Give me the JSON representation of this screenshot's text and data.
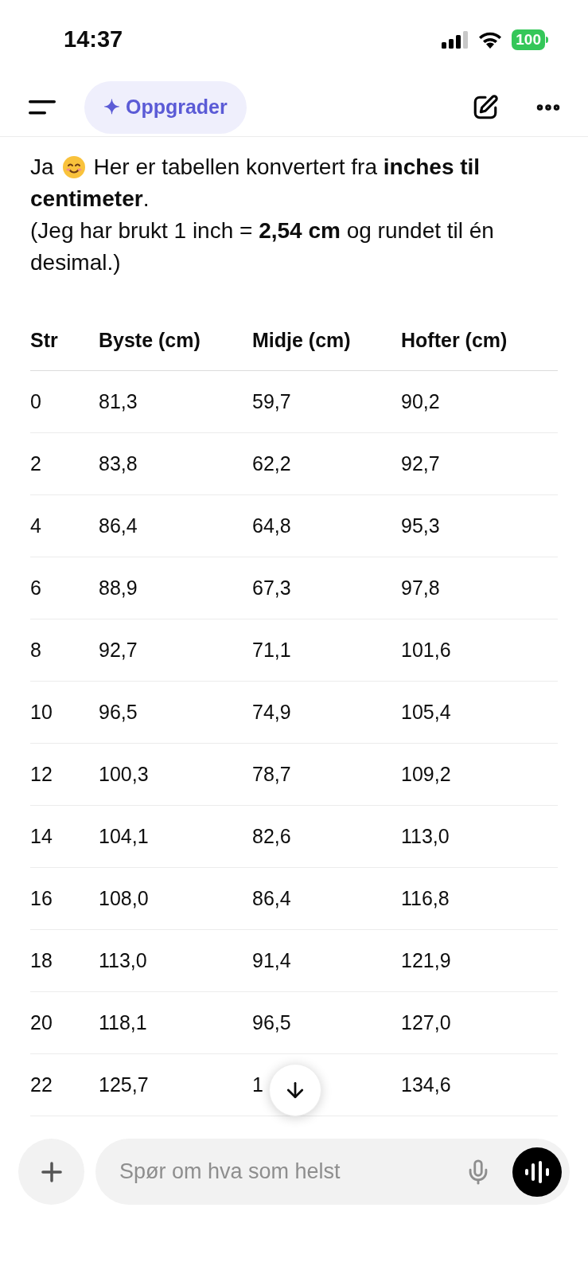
{
  "status_bar": {
    "time": "14:37",
    "battery": "100"
  },
  "nav": {
    "upgrade_button": "✦ Oppgrader"
  },
  "message": {
    "lead": "Ja",
    "text": "Her er tabellen konvertert fra **inches til**",
    "text_end": "**centimeter**.",
    "note": "(Jeg har brukt 1 inch = **2,54 cm** og rundet til én desimal.)"
  },
  "table": {
    "columns": [
      "Str",
      "Byste (cm)",
      "Midje (cm)",
      "Hofter (cm)"
    ],
    "rows": [
      [
        "0",
        "81,3",
        "59,7",
        "90,2"
      ],
      [
        "2",
        "83,8",
        "62,2",
        "92,7"
      ],
      [
        "4",
        "86,4",
        "64,8",
        "95,3"
      ],
      [
        "6",
        "88,9",
        "67,3",
        "97,8"
      ],
      [
        "8",
        "92,7",
        "71,1",
        "101,6"
      ],
      [
        "10",
        "96,5",
        "74,9",
        "105,4"
      ],
      [
        "12",
        "100,3",
        "78,7",
        "109,2"
      ],
      [
        "14",
        "104,1",
        "82,6",
        "113,0"
      ],
      [
        "16",
        "108,0",
        "86,4",
        "116,8"
      ],
      [
        "18",
        "113,0",
        "91,4",
        "121,9"
      ],
      [
        "20",
        "118,1",
        "96,5",
        "127,0"
      ],
      [
        "22",
        "125,7",
        "1",
        "134,6"
      ]
    ]
  },
  "composer": {
    "placeholder": "Spør om hva som helst"
  }
}
